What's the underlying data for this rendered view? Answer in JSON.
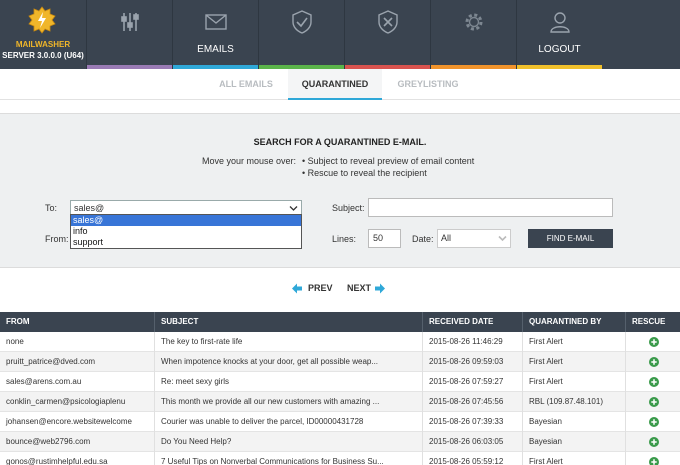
{
  "brand": {
    "name": "MAILWASHER",
    "version": "SERVER 3.0.0.0 (U64)"
  },
  "nav": [
    {
      "label": "",
      "icon": "settings-sliders-icon",
      "stripe": "#9a7bb5"
    },
    {
      "label": "EMAILS",
      "icon": "envelope-icon",
      "stripe": "#2fa8d8"
    },
    {
      "label": "",
      "icon": "shield-check-icon",
      "stripe": "#5bb44a"
    },
    {
      "label": "",
      "icon": "shield-x-icon",
      "stripe": "#d9534f"
    },
    {
      "label": "",
      "icon": "gear-icon",
      "stripe": "#f0932b"
    },
    {
      "label": "LOGOUT",
      "icon": "user-icon",
      "stripe": "#f0c02b"
    }
  ],
  "subtabs": [
    "ALL EMAILS",
    "QUARANTINED",
    "GREYLISTING"
  ],
  "search": {
    "title": "SEARCH FOR A QUARANTINED E-MAIL.",
    "hint_prefix": "Move your mouse over:",
    "hint_1": "• Subject to reveal preview of email content",
    "hint_2": "• Rescue to reveal the recipient",
    "to_label": "To:",
    "to_value": "sales@",
    "to_options": [
      "sales@",
      "info",
      "support"
    ],
    "from_label": "From:",
    "subject_label": "Subject:",
    "subject_value": "",
    "lines_label": "Lines:",
    "lines_value": "50",
    "date_label": "Date:",
    "date_value": "All",
    "find_label": "FIND E-MAIL"
  },
  "pager": {
    "prev": "PREV",
    "next": "NEXT"
  },
  "table": {
    "headers": [
      "FROM",
      "SUBJECT",
      "RECEIVED DATE",
      "QUARANTINED BY",
      "RESCUE"
    ],
    "rows": [
      [
        "none",
        "The key to first-rate life",
        "2015-08-26 11:46:29",
        "First Alert"
      ],
      [
        "pruitt_patrice@dved.com",
        "When impotence knocks at your door, get all possible weap...",
        "2015-08-26 09:59:03",
        "First Alert"
      ],
      [
        "sales@arens.com.au",
        "Re: meet sexy girls",
        "2015-08-26 07:59:27",
        "First Alert"
      ],
      [
        "conklin_carmen@psicologiaplenu",
        "This month we provide all our new customers with amazing ...",
        "2015-08-26 07:45:56",
        "RBL (109.87.48.101)"
      ],
      [
        "johansen@encore.websitewelcome",
        "Courier was unable to deliver the parcel, ID00000431728",
        "2015-08-26 07:39:33",
        "Bayesian"
      ],
      [
        "bounce@web2796.com",
        "Do You Need Help?",
        "2015-08-26 06:03:05",
        "Bayesian"
      ],
      [
        "gonos@rustimhelpful.edu.sa",
        "7 Useful Tips on Nonverbal Communications for Business Su...",
        "2015-08-26 05:59:12",
        "First Alert"
      ]
    ]
  },
  "colors": {
    "navbar": "#3a4450",
    "accent": "#2fa8d8",
    "rescue": "#3a9a4a",
    "brand": "#f0b62a"
  }
}
